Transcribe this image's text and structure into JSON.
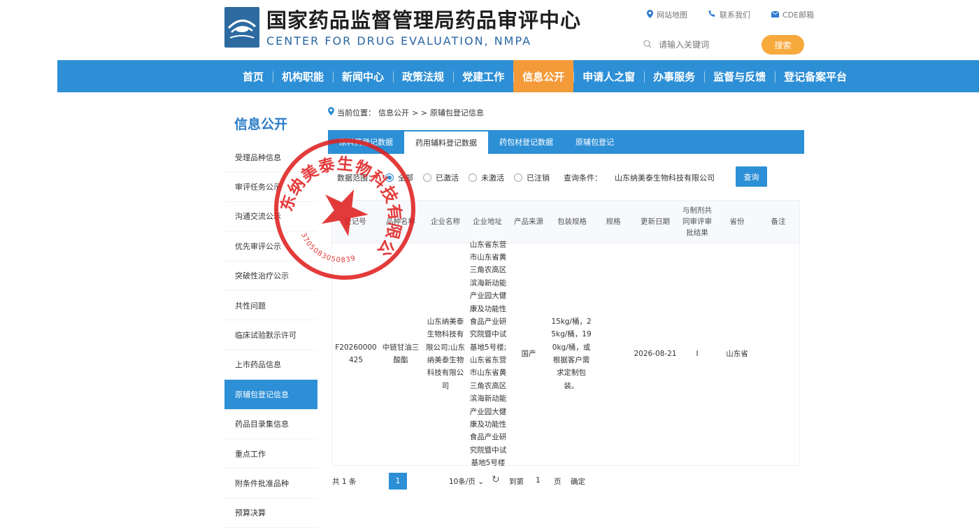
{
  "header": {
    "title_cn": "国家药品监督管理局药品审评中心",
    "title_en": "CENTER FOR DRUG EVALUATION, NMPA",
    "links": [
      {
        "label": "网站地图",
        "icon": "location-pin-icon"
      },
      {
        "label": "联系我们",
        "icon": "phone-icon"
      },
      {
        "label": "CDE邮箱",
        "icon": "mail-icon"
      }
    ],
    "search_placeholder": "请输入关键词",
    "search_button": "搜索"
  },
  "nav": {
    "items": [
      "首页",
      "机构职能",
      "新闻中心",
      "政策法规",
      "党建工作",
      "信息公开",
      "申请人之窗",
      "办事服务",
      "监督与反馈",
      "登记备案平台"
    ],
    "active_index": 5
  },
  "sidebar": {
    "title": "信息公开",
    "items": [
      "受理品种信息",
      "审评任务公示",
      "沟通交流公示",
      "优先审评公示",
      "突破性治疗公示",
      "共性问题",
      "临床试验默示许可",
      "上市药品信息",
      "原辅包登记信息",
      "药品目录集信息",
      "重点工作",
      "附条件批准品种",
      "预算决算"
    ],
    "active_index": 8
  },
  "breadcrumb": {
    "prefix": "当前位置：",
    "path": [
      "信息公开",
      "原辅包登记信息"
    ],
    "separator": "> >"
  },
  "tabs": {
    "items": [
      "原料药登记数据",
      "药用辅料登记数据",
      "药包材登记数据",
      "原辅包登记"
    ],
    "active_index": 1
  },
  "filter": {
    "range_label": "数据范围：",
    "options": [
      "全部",
      "已激活",
      "未激活",
      "已注销"
    ],
    "selected_index": 0,
    "condition_label": "查询条件：",
    "condition_value": "山东纳美泰生物科技有限公司",
    "query_button": "查询"
  },
  "table": {
    "headers": [
      "登记号",
      "品种名称",
      "企业名称",
      "企业地址",
      "产品来源",
      "包装规格",
      "规格",
      "更新日期",
      "与制剂共同审评审批结果",
      "省份",
      "备注"
    ],
    "rows": [
      [
        "F20260000425",
        "中链甘油三酸酯",
        "山东纳美泰生物科技有限公司;山东纳美泰生物科技有限公司",
        "山东省东营市山东省黄三角农高区滨海新动能产业园大健康及功能性食品产业研究院暨中试基地5号楼;山东省东营市山东省黄三角农高区滨海新动能产业园大健康及功能性食品产业研究院暨中试基地5号楼",
        "国产",
        "15kg/桶，25kg/桶，190kg/桶，或根据客户需求定制包装。",
        "",
        "2026-08-21",
        "I",
        "山东省",
        ""
      ]
    ]
  },
  "pagination": {
    "total": "共 1 条",
    "current_page": "1",
    "page_size": "10条/页",
    "goto_label": "到第",
    "goto_value": "1",
    "page_unit": "页",
    "confirm": "确定"
  },
  "stamp": {
    "text": "山东纳美泰生物科技有限公司",
    "number": "3705083050839",
    "color": "#e02020"
  },
  "colors": {
    "primary": "#2d8fd6",
    "accent": "#f39a39",
    "search_button": "#f7a93c"
  }
}
